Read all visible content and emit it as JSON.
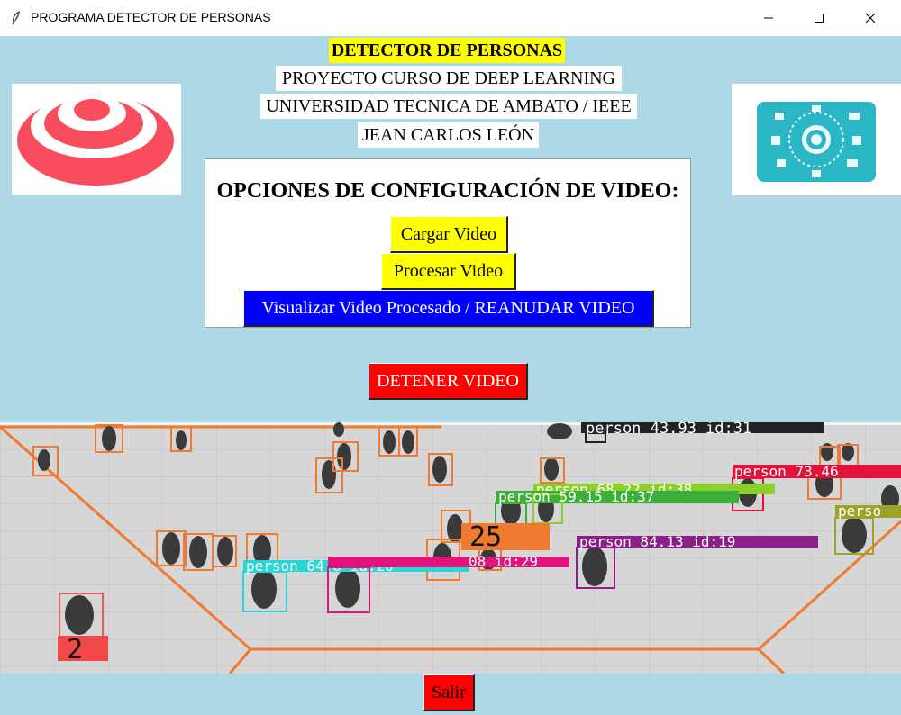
{
  "window": {
    "title": "PROGRAMA DETECTOR DE PERSONAS",
    "controls": {
      "minimize": "─",
      "maximize": "☐",
      "close": "✕"
    }
  },
  "header": {
    "title": "DETECTOR DE PERSONAS",
    "course": "PROYECTO CURSO DE DEEP LEARNING",
    "university": "UNIVERSIDAD TECNICA DE AMBATO / IEEE",
    "author": "JEAN CARLOS LEÓN"
  },
  "config": {
    "title": "OPCIONES DE CONFIGURACIÓN DE VIDEO:",
    "load_label": "Cargar Video",
    "process_label": "Procesar Video",
    "view_label": "Visualizar Video Procesado / REANUDAR VIDEO"
  },
  "stop_label": "DETENER VIDEO",
  "exit_label": "Salir",
  "video": {
    "counter_in": "25",
    "counter_out": "2",
    "labels": [
      "person 43.93 id:31",
      "person 73.46",
      "person 68.22 id:38",
      "person 59.15 id:37",
      "perso",
      "person 84.13 id:19",
      "person 64.8 id:20",
      "08 id:29"
    ]
  },
  "colors": {
    "background": "#add8e6",
    "title_highlight": "#ffff00",
    "button_yellow": "#ffff00",
    "button_blue": "#0000ff",
    "button_red": "#ff0000"
  },
  "icons": {
    "app": "feather-icon",
    "left_logo": "concentric-target-logo",
    "right_logo": "ai-brain-logo"
  }
}
